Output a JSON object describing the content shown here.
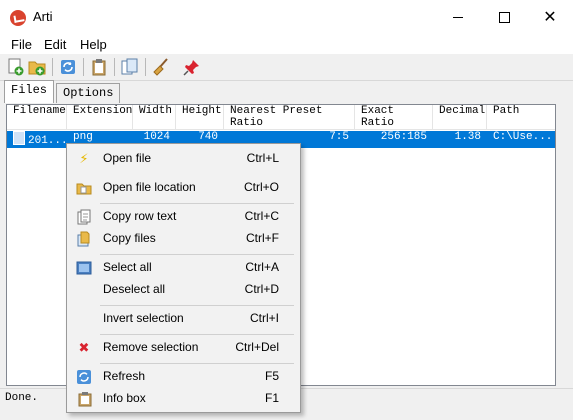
{
  "window": {
    "title": "Arti"
  },
  "menubar": {
    "items": [
      "File",
      "Edit",
      "Help"
    ]
  },
  "tabs": [
    {
      "label": "Files",
      "active": true
    },
    {
      "label": "Options",
      "active": false
    }
  ],
  "table": {
    "columns": [
      "Filename",
      "Extension",
      "Width",
      "Height",
      "Nearest Preset Ratio",
      "Exact Ratio",
      "Decimal",
      "Path"
    ],
    "rows": [
      {
        "filename": "201...",
        "extension": "png",
        "width": "1024",
        "height": "740",
        "nearest": "7:5",
        "exact": "256:185",
        "decimal": "1.38",
        "path": "C:\\Use..."
      }
    ]
  },
  "status": {
    "text": "Done."
  },
  "context_menu": {
    "items": [
      {
        "label": "Open file",
        "shortcut": "Ctrl+L",
        "icon": "lightning-icon"
      },
      {
        "label": "Open file location",
        "shortcut": "Ctrl+O",
        "icon": "folder-icon"
      },
      {
        "label": "Copy row text",
        "shortcut": "Ctrl+C",
        "icon": "copy-text-icon"
      },
      {
        "label": "Copy files",
        "shortcut": "Ctrl+F",
        "icon": "copy-files-icon"
      },
      {
        "label": "Select all",
        "shortcut": "Ctrl+A",
        "icon": "select-all-icon"
      },
      {
        "label": "Deselect all",
        "shortcut": "Ctrl+D",
        "icon": ""
      },
      {
        "label": "Invert selection",
        "shortcut": "Ctrl+I",
        "icon": ""
      },
      {
        "label": "Remove selection",
        "shortcut": "Ctrl+Del",
        "icon": "remove-icon"
      },
      {
        "label": "Refresh",
        "shortcut": "F5",
        "icon": "refresh-icon"
      },
      {
        "label": "Info box",
        "shortcut": "F1",
        "icon": "info-box-icon"
      }
    ]
  },
  "colors": {
    "selection": "#0078d7",
    "remove_icon": "#d9232f",
    "app_icon": "#d9432e"
  }
}
